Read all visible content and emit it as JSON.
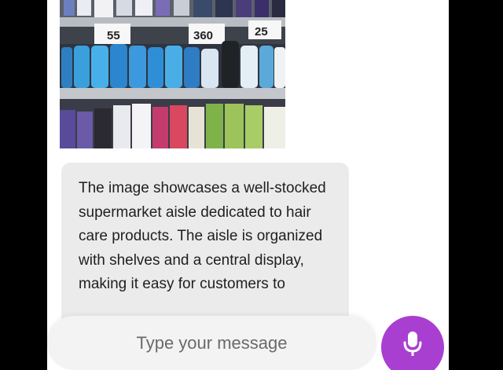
{
  "shelf_image": {
    "price_tags": [
      "55",
      "360",
      "25"
    ]
  },
  "message": {
    "text": "The image showcases a well-stocked supermarket aisle dedicated to hair care products. The aisle is organized with shelves and a central display, making it easy for customers to"
  },
  "composer": {
    "placeholder": "Type your message"
  },
  "icons": {
    "mic": "microphone-icon"
  },
  "colors": {
    "accent": "#a93fd0",
    "bubble": "#ebebec",
    "background": "#ffffff"
  }
}
